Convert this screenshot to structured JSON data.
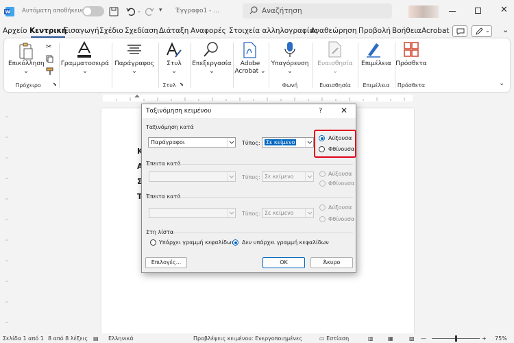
{
  "titlebar": {
    "autosave_label": "Αυτόματη αποθήκευση",
    "doc_name": "Έγγραφο1",
    "doc_suffix": "- ...",
    "search_placeholder": "Αναζήτηση"
  },
  "menu": {
    "tabs": [
      "Αρχείο",
      "Κεντρική",
      "Εισαγωγή",
      "Σχέδιο",
      "Σχεδίαση",
      "Διάταξη",
      "Αναφορές",
      "Στοιχεία αλληλογραφίας",
      "Αναθεώρηση",
      "Προβολή",
      "Βοήθεια",
      "Acrobat"
    ]
  },
  "ribbon": {
    "paste": "Επικόλληση",
    "clipboard": "Πρόχειρο",
    "font": "Γραμματοσειρά",
    "paragraph": "Παράγραφος",
    "styles": "Στυλ",
    "styles_group": "Στυλ",
    "editing": "Επεξεργασία",
    "acrobat_line1": "Adobe",
    "acrobat_line2": "Acrobat",
    "dictate": "Υπαγόρευση",
    "voice_group": "Φωνή",
    "sensitivity": "Ευαισθησία",
    "sensitivity_group": "Ευαισθησία",
    "editor": "Επιμέλεια",
    "editor_group": "Επιμέλεια",
    "addins": "Πρόσθετα",
    "addins_group": "Πρόσθετα"
  },
  "document": {
    "visible_letters": [
      "Κ",
      "Α",
      "Σ",
      "Τ"
    ]
  },
  "dialog": {
    "title": "Ταξινόμηση κειμένου",
    "help": "?",
    "sort_by_label": "Ταξινόμηση κατά",
    "sort_by_value": "Παράγραφοι",
    "type_label": "Τύπος:",
    "type_value": "Σε κείμενο",
    "ascending": "Αύξουσα",
    "descending": "Φθίνουσα",
    "then_by_label_1": "Έπειτα κατά",
    "then_by_label_2": "Έπειτα κατά",
    "type_label_2": "Τύπος:",
    "type_value_2": "Σε κείμενο",
    "type_label_3": "Τύπος:",
    "type_value_3": "Σε κείμενο",
    "list_label": "Στη λίστα",
    "header_row": "Υπάρχει γραμμή κεφαλίδων",
    "no_header_row": "Δεν υπάρχει γραμμή κεφαλίδων",
    "options_button": "Επιλογές...",
    "ok_button": "OK",
    "cancel_button": "Άκυρο"
  },
  "status": {
    "page": "Σελίδα 1 από 1",
    "words": "8 από 8 λέξεις",
    "language": "Ελληνικά",
    "predictions": "Προβλέψεις κειμένου: Ενεργοποιημένες",
    "focus": "Εστίαση",
    "zoom": "75%"
  },
  "colors": {
    "accent": "#2b579a",
    "highlight_box": "#e0001b",
    "selection": "#0067c0"
  }
}
